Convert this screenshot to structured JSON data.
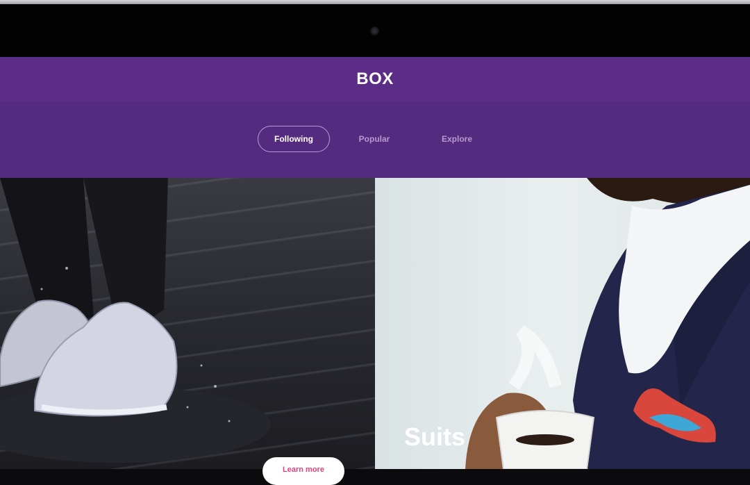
{
  "app": {
    "title": "BOX"
  },
  "tabs": [
    {
      "label": "Following",
      "active": true
    },
    {
      "label": "Popular",
      "active": false
    },
    {
      "label": "Explore",
      "active": false
    }
  ],
  "cards": [
    {
      "name": "sneakers-card",
      "title": "",
      "button_label": "Learn more"
    },
    {
      "name": "suits-card",
      "title": "Suits"
    }
  ],
  "colors": {
    "header": "#5b2d86",
    "tab_bar": "#552b7f",
    "active_tab_border": "#b99ad6",
    "button_text": "#e0407a"
  }
}
